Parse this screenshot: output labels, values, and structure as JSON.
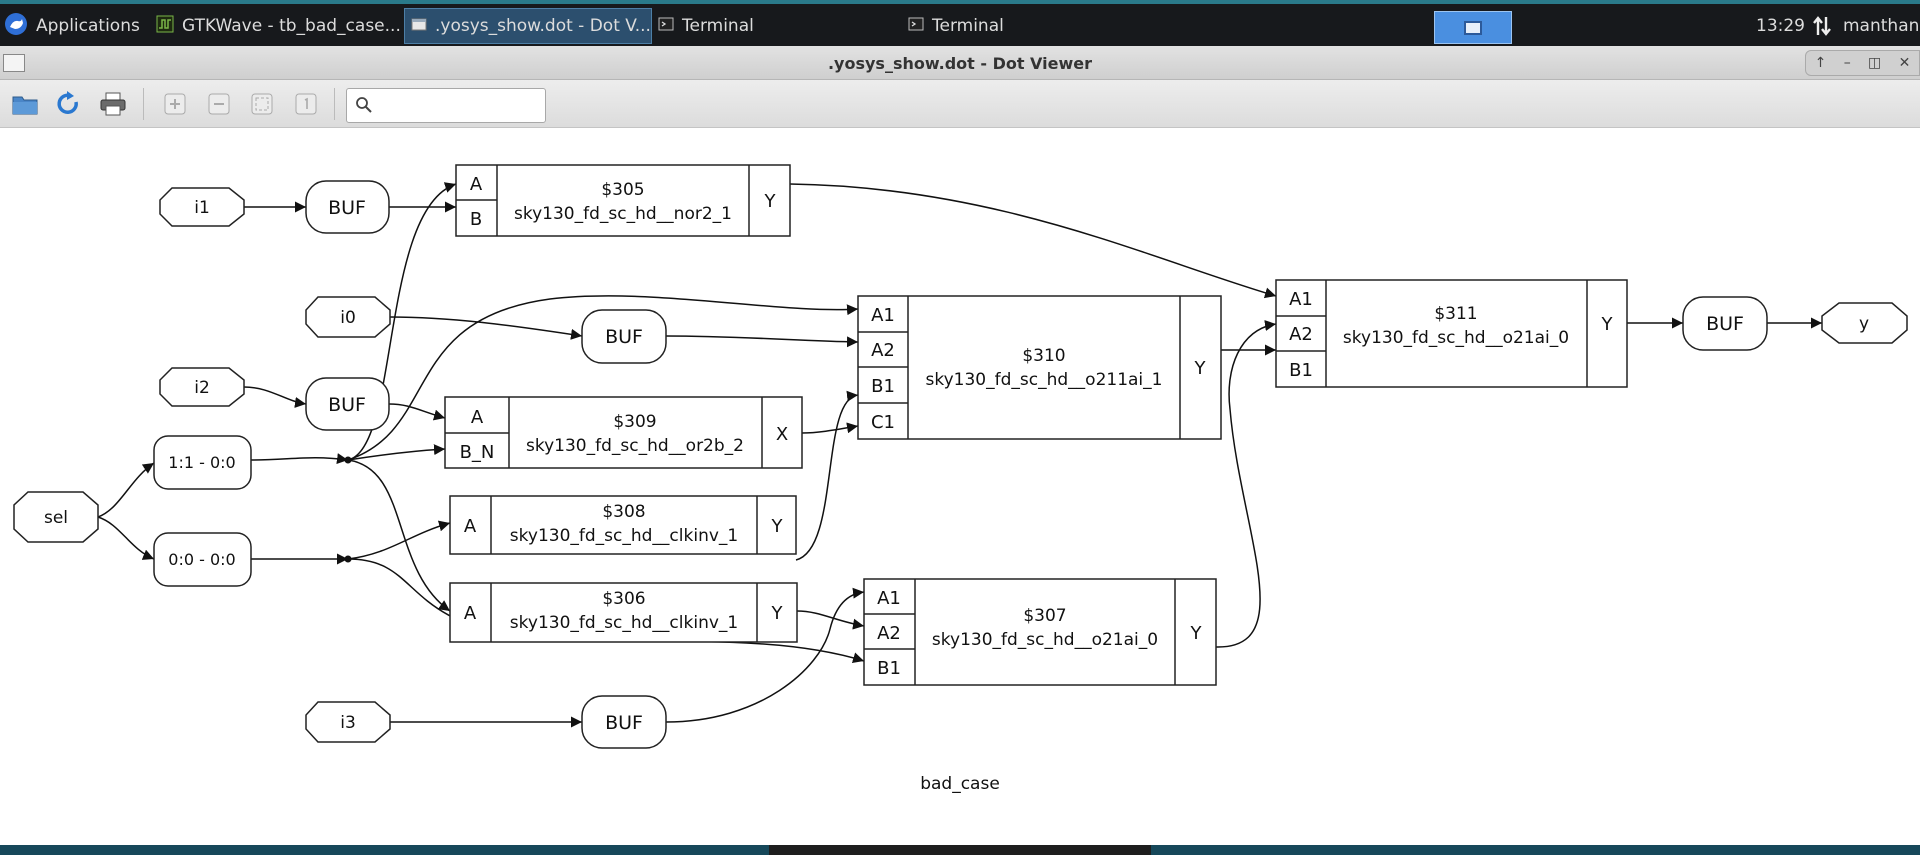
{
  "taskbar": {
    "apps_label": "Applications",
    "tasks": [
      {
        "label": "GTKWave - tb_bad_case..."
      },
      {
        "label": ".yosys_show.dot - Dot V..."
      },
      {
        "label": "Terminal"
      },
      {
        "label": "Terminal"
      }
    ],
    "clock": "13:29",
    "user": "manthan"
  },
  "window": {
    "title": ".yosys_show.dot - Dot Viewer",
    "search_placeholder": ""
  },
  "graph": {
    "title": "bad_case",
    "io": [
      {
        "id": "i1",
        "label": "i1"
      },
      {
        "id": "i0",
        "label": "i0"
      },
      {
        "id": "i2",
        "label": "i2"
      },
      {
        "id": "sel",
        "label": "sel"
      },
      {
        "id": "i3",
        "label": "i3"
      },
      {
        "id": "y",
        "label": "y"
      }
    ],
    "bufs": [
      {
        "id": "buf-i1",
        "label": "BUF"
      },
      {
        "id": "buf-i0",
        "label": "BUF"
      },
      {
        "id": "buf-i2",
        "label": "BUF"
      },
      {
        "id": "buf-i3",
        "label": "BUF"
      },
      {
        "id": "buf-y",
        "label": "BUF"
      }
    ],
    "slices": [
      {
        "id": "slice-1",
        "label": "1:1 - 0:0"
      },
      {
        "id": "slice-0",
        "label": "0:0 - 0:0"
      }
    ],
    "cells": [
      {
        "id": "c305",
        "name": "$305",
        "type": "sky130_fd_sc_hd__nor2_1",
        "inputs": [
          "A",
          "B"
        ],
        "output": "Y"
      },
      {
        "id": "c310",
        "name": "$310",
        "type": "sky130_fd_sc_hd__o211ai_1",
        "inputs": [
          "A1",
          "A2",
          "B1",
          "C1"
        ],
        "output": "Y"
      },
      {
        "id": "c311",
        "name": "$311",
        "type": "sky130_fd_sc_hd__o21ai_0",
        "inputs": [
          "A1",
          "A2",
          "B1"
        ],
        "output": "Y"
      },
      {
        "id": "c309",
        "name": "$309",
        "type": "sky130_fd_sc_hd__or2b_2",
        "inputs": [
          "A",
          "B_N"
        ],
        "output": "X"
      },
      {
        "id": "c308",
        "name": "$308",
        "type": "sky130_fd_sc_hd__clkinv_1",
        "inputs": [
          "A"
        ],
        "output": "Y"
      },
      {
        "id": "c306",
        "name": "$306",
        "type": "sky130_fd_sc_hd__clkinv_1",
        "inputs": [
          "A"
        ],
        "output": "Y"
      },
      {
        "id": "c307",
        "name": "$307",
        "type": "sky130_fd_sc_hd__o21ai_0",
        "inputs": [
          "A1",
          "A2",
          "B1"
        ],
        "output": "Y"
      }
    ]
  }
}
